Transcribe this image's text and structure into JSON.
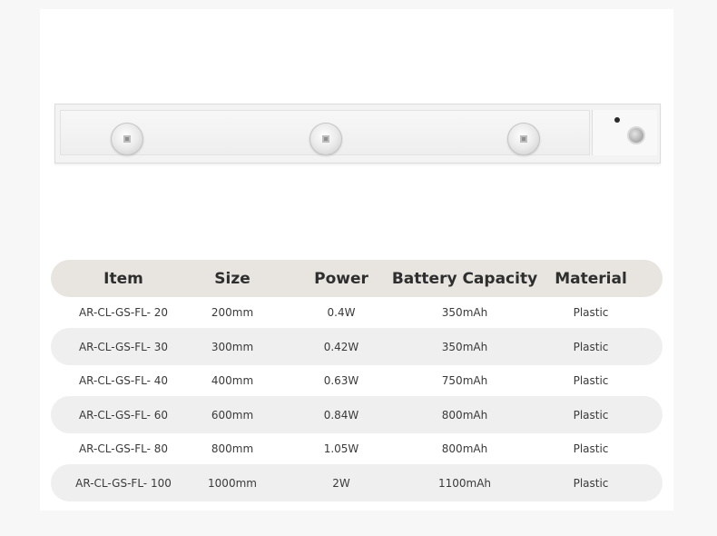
{
  "table": {
    "headers": [
      "Item",
      "Size",
      "Power",
      "Battery Capacity",
      "Material"
    ],
    "rows": [
      [
        "AR-CL-GS-FL- 20",
        "200mm",
        "0.4W",
        "350mAh",
        "Plastic"
      ],
      [
        "AR-CL-GS-FL- 30",
        "300mm",
        "0.42W",
        "350mAh",
        "Plastic"
      ],
      [
        "AR-CL-GS-FL- 40",
        "400mm",
        "0.63W",
        "750mAh",
        "Plastic"
      ],
      [
        "AR-CL-GS-FL- 60",
        "600mm",
        "0.84W",
        "800mAh",
        "Plastic"
      ],
      [
        "AR-CL-GS-FL- 80",
        "800mm",
        "1.05W",
        "800mAh",
        "Plastic"
      ],
      [
        "AR-CL-GS-FL- 100",
        "1000mm",
        "2W",
        "1100mAh",
        "Plastic"
      ]
    ]
  },
  "colors": {
    "header_bg": "#e8e5e0",
    "row_shade_bg": "#efefef",
    "text": "#3a3a3a"
  },
  "icons": [
    "led-lamp-icon",
    "motion-sensor-icon",
    "indicator-dot-icon"
  ]
}
